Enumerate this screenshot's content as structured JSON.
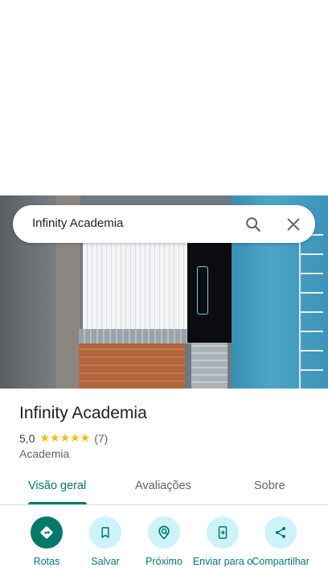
{
  "search": {
    "value": "Infinity Academia"
  },
  "place": {
    "title": "Infinity Academia",
    "rating": "5,0",
    "stars": "★★★★★",
    "review_count": "(7)",
    "category": "Academia"
  },
  "tabs": [
    {
      "label": "Visão geral",
      "active": true
    },
    {
      "label": "Avaliações",
      "active": false
    },
    {
      "label": "Sobre",
      "active": false
    }
  ],
  "actions": [
    {
      "label": "Rotas",
      "icon": "directions-icon"
    },
    {
      "label": "Salvar",
      "icon": "bookmark-icon"
    },
    {
      "label": "Próximo",
      "icon": "nearby-icon"
    },
    {
      "label": "Enviar para o",
      "icon": "send-to-phone-icon"
    },
    {
      "label": "Compartilhar",
      "icon": "share-icon"
    }
  ],
  "colors": {
    "accent": "#00796b",
    "action_bg": "#cdf3f9",
    "star": "#fbbc04"
  }
}
